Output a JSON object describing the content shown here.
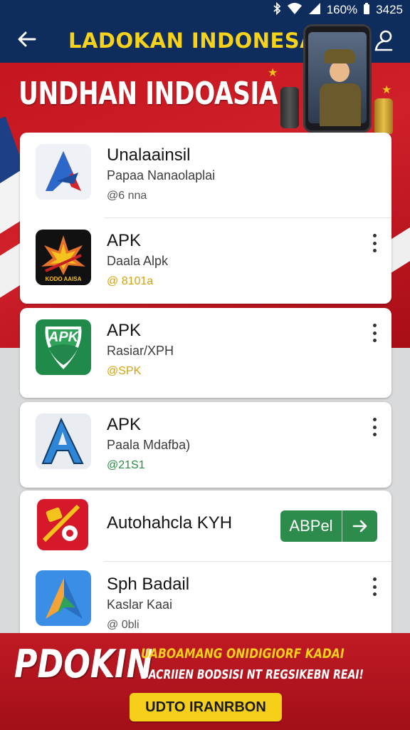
{
  "status_bar": {
    "battery_text": "160%",
    "time": "3425",
    "icons": [
      "bluetooth-icon",
      "wifi-icon",
      "signal-icon",
      "battery-icon"
    ]
  },
  "header": {
    "title": "LADOKAN INDONESA",
    "back_icon": "arrow-left-icon",
    "profile_icon": "user-icon",
    "colors": {
      "bar": "#0e2c5c",
      "title": "#f6d21b"
    }
  },
  "banner": {
    "title": "UNDHAN INDOASIA",
    "color": "#c4161f"
  },
  "apps": [
    {
      "name": "Unalaainsil",
      "subtitle": "Papaa Nanaolaplai",
      "meta": "@6 nna",
      "meta_color": "#555555",
      "icon": "arrow-a-icon",
      "has_more": false
    },
    {
      "name": "APK",
      "subtitle": "Daala Alpk",
      "meta": "@ 8101a",
      "meta_color": "#d4a20d",
      "icon": "leaf-logo-icon",
      "icon_text": "KODO AAISA",
      "has_more": true
    },
    {
      "name": "APK",
      "subtitle": "Rasiar/XPH",
      "meta": "@SPK",
      "meta_color": "#d4a20d",
      "icon": "apk-shield-icon",
      "icon_text": "APK",
      "has_more": true
    },
    {
      "name": "APK",
      "subtitle": "Paala Mdafba)",
      "meta": "@21S1",
      "meta_color": "#2a8a45",
      "icon": "a-letter-icon",
      "has_more": true
    },
    {
      "name": "Autohahcla KYH",
      "subtitle": "",
      "meta": "",
      "meta_color": "#555555",
      "icon": "ticket-icon",
      "cta_label": "ABPel",
      "has_more": false
    },
    {
      "name": "Sph Badail",
      "subtitle": "Kaslar Kaai",
      "meta": "@ 0bli",
      "meta_color": "#555555",
      "icon": "paper-plane-icon",
      "has_more": true
    }
  ],
  "promo": {
    "logo": "PDOKIN",
    "line1": "UABOAMANG ONIDIGIORF KADAI",
    "line2": "BACRIIEN BODSISI NT REGSIKEBN REAI!",
    "button": "UDTO IRANRBON"
  }
}
